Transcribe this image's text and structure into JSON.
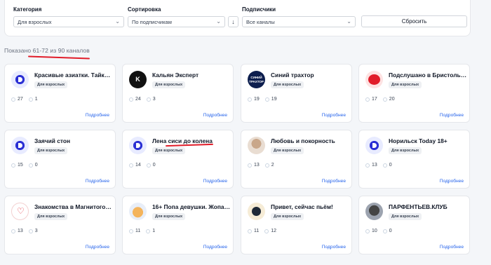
{
  "filters": {
    "category": {
      "label": "Категория",
      "value": "Для взрослых"
    },
    "sort": {
      "label": "Сортировка",
      "value": "По подписчикам",
      "direction_icon": "arrow-down-icon"
    },
    "subscribers": {
      "label": "Подписчики",
      "value": "Все каналы"
    },
    "reset_label": "Сбросить"
  },
  "shown_text": "Показано 61-72 из 90 каналов",
  "annotation_color": "#e11d2a",
  "link_color": "#2563eb",
  "cards": [
    {
      "title": "Красивые азиатки. Тайки, ...",
      "badge": "Для взрослых",
      "stat1": "27",
      "stat2": "1",
      "more": "Подробнее",
      "avatar": "logo-icon"
    },
    {
      "title": "Кальян Эксперт",
      "badge": "Для взрослых",
      "stat1": "24",
      "stat2": "3",
      "more": "Подробнее",
      "avatar": "kalyan-logo"
    },
    {
      "title": "Синий трахтор",
      "badge": "Для взрослых",
      "stat1": "19",
      "stat2": "19",
      "more": "Подробнее",
      "avatar": "tractor-logo",
      "avatar_text": "СИНИЙ ТРАХТОР"
    },
    {
      "title": "Подслушано в Бристоль 1...",
      "badge": "Для взрослых",
      "stat1": "17",
      "stat2": "20",
      "more": "Подробнее",
      "avatar": "bristol-logo"
    },
    {
      "title": "Заячий стон",
      "badge": "Для взрослых",
      "stat1": "15",
      "stat2": "0",
      "more": "Подробнее",
      "avatar": "logo-icon"
    },
    {
      "title": "Лена сиси до колена",
      "badge": "Для взрослых",
      "stat1": "14",
      "stat2": "0",
      "more": "Подробнее",
      "avatar": "logo-icon"
    },
    {
      "title": "Любовь и покорность",
      "badge": "Для взрослых",
      "stat1": "13",
      "stat2": "2",
      "more": "Подробнее",
      "avatar": "photo"
    },
    {
      "title": "Норильск Today 18+",
      "badge": "Для взрослых",
      "stat1": "13",
      "stat2": "0",
      "more": "Подробнее",
      "avatar": "logo-icon"
    },
    {
      "title": "Знакомства в Магнитогорс...",
      "badge": "Для взрослых",
      "stat1": "13",
      "stat2": "3",
      "more": "Подробнее",
      "avatar": "heart-logo"
    },
    {
      "title": "16+ Попа девушки. Жопас...",
      "badge": "Для взрослых",
      "stat1": "11",
      "stat2": "1",
      "more": "Подробнее",
      "avatar": "peach-photo"
    },
    {
      "title": "Привет, сейчас пьём!",
      "badge": "Для взрослых",
      "stat1": "11",
      "stat2": "12",
      "more": "Подробнее",
      "avatar": "beer-logo"
    },
    {
      "title": "ПАРФЕНТЬЕВ.КЛУБ",
      "badge": "Для взрослых",
      "stat1": "10",
      "stat2": "0",
      "more": "Подробнее",
      "avatar": "bw-photo"
    }
  ]
}
